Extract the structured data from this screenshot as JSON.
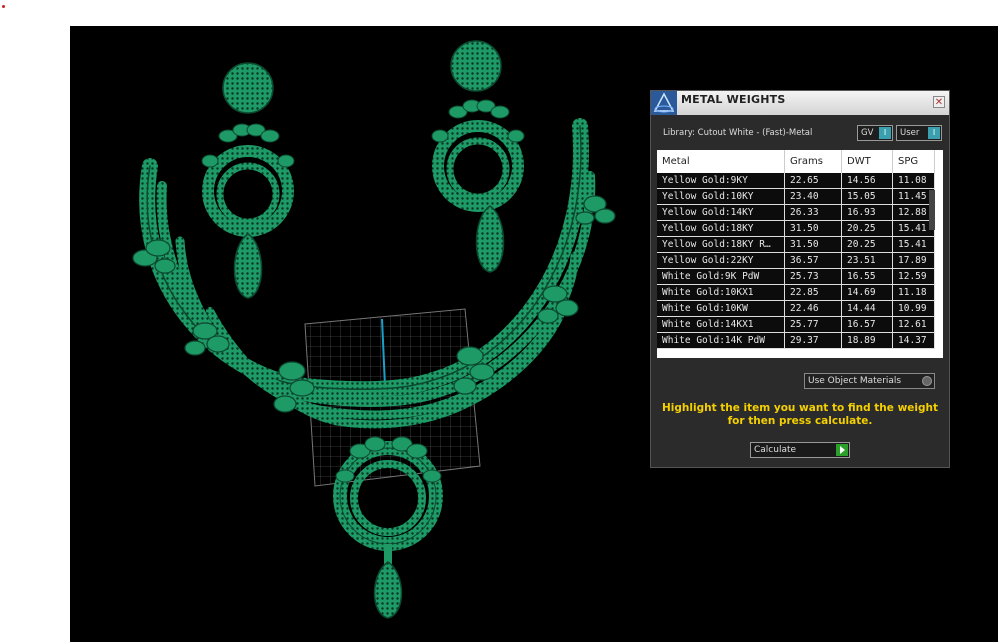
{
  "panel": {
    "title": "METAL WEIGHTS",
    "close_glyph": "✕",
    "library_label": "Library: Cutout White - (Fast)-Metal",
    "toggles": [
      {
        "label": "GV",
        "knob": "I"
      },
      {
        "label": "User",
        "knob": "I"
      }
    ],
    "table": {
      "headers": [
        "Metal",
        "Grams",
        "DWT",
        "SPG"
      ],
      "rows": [
        [
          "Yellow Gold:9KY",
          "22.65",
          "14.56",
          "11.08"
        ],
        [
          "Yellow Gold:10KY",
          "23.40",
          "15.05",
          "11.45"
        ],
        [
          "Yellow Gold:14KY",
          "26.33",
          "16.93",
          "12.88"
        ],
        [
          "Yellow Gold:18KY",
          "31.50",
          "20.25",
          "15.41"
        ],
        [
          "Yellow Gold:18KY R…",
          "31.50",
          "20.25",
          "15.41"
        ],
        [
          "Yellow Gold:22KY",
          "36.57",
          "23.51",
          "17.89"
        ],
        [
          "White Gold:9K PdW",
          "25.73",
          "16.55",
          "12.59"
        ],
        [
          "White Gold:10KX1",
          "22.85",
          "14.69",
          "11.18"
        ],
        [
          "White Gold:10KW",
          "22.46",
          "14.44",
          "10.99"
        ],
        [
          "White Gold:14KX1",
          "25.77",
          "16.57",
          "12.61"
        ],
        [
          "White Gold:14K PdW",
          "29.37",
          "18.89",
          "14.37"
        ]
      ]
    },
    "material_select": "Use Object Materials",
    "instruction_line1": "Highlight the item you want to find the weight",
    "instruction_line2": "for then press calculate.",
    "calculate_label": "Calculate"
  },
  "colors": {
    "jewelry": "#1a8a5c",
    "jewelry_dark": "#0c4a30",
    "highlight": "#f5d000",
    "viewport_bg": "#000000"
  },
  "icons": [
    "app-logo-icon",
    "close-icon",
    "toggle-knob-icon",
    "dropdown-icon",
    "go-arrow-icon"
  ]
}
